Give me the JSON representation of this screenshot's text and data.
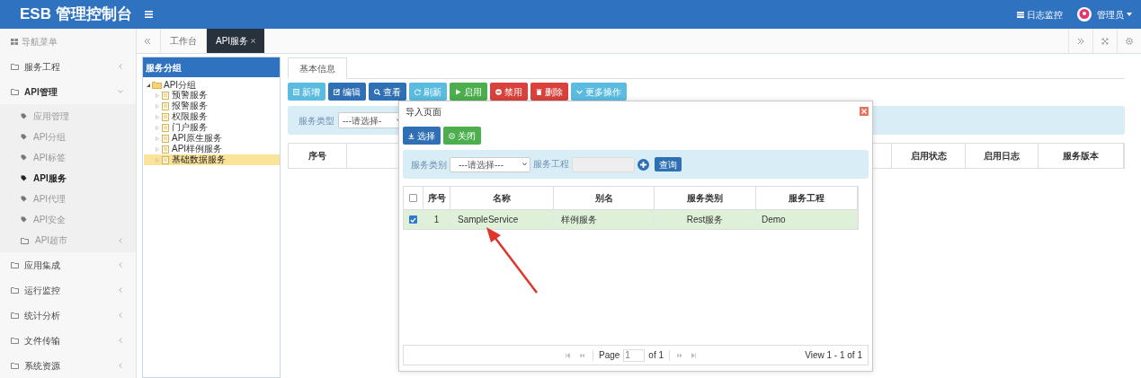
{
  "header": {
    "logo": "ESB 管理控制台",
    "log_link": "日志监控",
    "user": "管理员"
  },
  "sidebar": {
    "title": "导航菜单",
    "items": [
      {
        "label": "服务工程",
        "expanded": false
      },
      {
        "label": "API管理",
        "expanded": true,
        "children": [
          {
            "label": "应用管理",
            "kind": "leaf",
            "selected": false
          },
          {
            "label": "API分组",
            "kind": "leaf",
            "selected": false
          },
          {
            "label": "API标签",
            "kind": "leaf",
            "selected": false
          },
          {
            "label": "API服务",
            "kind": "leaf",
            "selected": true
          },
          {
            "label": "API代理",
            "kind": "leaf",
            "selected": false
          },
          {
            "label": "API安全",
            "kind": "leaf",
            "selected": false
          },
          {
            "label": "API超市",
            "kind": "folder",
            "selected": false
          }
        ]
      },
      {
        "label": "应用集成",
        "expanded": false
      },
      {
        "label": "运行监控",
        "expanded": false
      },
      {
        "label": "统计分析",
        "expanded": false
      },
      {
        "label": "文件传输",
        "expanded": false
      },
      {
        "label": "系统资源",
        "expanded": false
      }
    ]
  },
  "tabs": [
    {
      "label": "工作台",
      "selected": false,
      "closable": false
    },
    {
      "label": "API服务",
      "selected": true,
      "closable": true
    }
  ],
  "tree": {
    "title": "服务分组",
    "root": {
      "label": "API分组",
      "expanded": true,
      "children": [
        {
          "label": "预警服务",
          "selected": false
        },
        {
          "label": "报警服务",
          "selected": false
        },
        {
          "label": "权限服务",
          "selected": false
        },
        {
          "label": "门户服务",
          "selected": false
        },
        {
          "label": "API原生服务",
          "selected": false
        },
        {
          "label": "API样例服务",
          "selected": false
        },
        {
          "label": "基础数据服务",
          "selected": true
        }
      ]
    }
  },
  "detail": {
    "tabs": [
      {
        "label": "基本信息",
        "selected": true
      }
    ],
    "toolbar": [
      {
        "label": "新增",
        "kind": "info"
      },
      {
        "label": "编辑",
        "kind": "primary"
      },
      {
        "label": "查看",
        "kind": "primary"
      },
      {
        "label": "刷新",
        "kind": "info"
      },
      {
        "label": "启用",
        "kind": "success"
      },
      {
        "label": "禁用",
        "kind": "danger"
      },
      {
        "label": "删除",
        "kind": "danger"
      },
      {
        "label": "更多操作",
        "kind": "info"
      }
    ],
    "search": {
      "label": "服务类型",
      "select": "---请选择-"
    },
    "table": {
      "columns": [
        "序号",
        "启用状态",
        "启用日志",
        "服务版本"
      ]
    }
  },
  "dialog": {
    "title": "导入页面",
    "buttons": [
      {
        "label": "选择",
        "kind": "primary"
      },
      {
        "label": "关闭",
        "kind": "success"
      }
    ],
    "filter": {
      "type_label": "服务类别",
      "type_select": "---请选择---",
      "project_label": "服务工程",
      "query_button": "查询"
    },
    "table": {
      "all_checked": false,
      "columns": [
        "序号",
        "名称",
        "别名",
        "服务类别",
        "服务工程"
      ],
      "rows": [
        {
          "checked": true,
          "selected": true,
          "cells": [
            "1",
            "SampleService",
            "样例服务",
            "Rest服务",
            "Demo"
          ]
        }
      ]
    },
    "pager": {
      "page_label": "Page",
      "page": "1",
      "of": "of 1",
      "view": "View 1 - 1 of 1"
    }
  }
}
